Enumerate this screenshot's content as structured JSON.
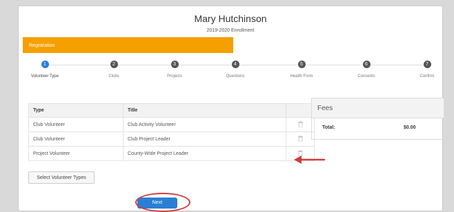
{
  "header": {
    "name": "Mary Hutchinson",
    "enrollment": "2019-2020 Enrollment"
  },
  "progress": {
    "label": "Registration"
  },
  "steps": [
    {
      "number": "1",
      "label": "Volunteer Type",
      "active": true
    },
    {
      "number": "2",
      "label": "Clubs"
    },
    {
      "number": "3",
      "label": "Projects"
    },
    {
      "number": "4",
      "label": "Questions"
    },
    {
      "number": "5",
      "label": "Health Form"
    },
    {
      "number": "6",
      "label": "Consents"
    },
    {
      "number": "7",
      "label": "Confirm"
    }
  ],
  "volunteer_table": {
    "headers": [
      "Type",
      "Title",
      ""
    ],
    "rows": [
      {
        "type": "Club Volunteer",
        "title": "Club Activity Volunteer"
      },
      {
        "type": "Club Volunteer",
        "title": "Club Project Leader"
      },
      {
        "type": "Project Volunteer",
        "title": "County-Wide Project Leader"
      }
    ]
  },
  "fees": {
    "heading": "Fees",
    "total_label": "Total:",
    "total_value": "$0.00"
  },
  "buttons": {
    "select_types": "Select Volunteer Types",
    "next": "Next"
  },
  "colors": {
    "progress_bar": "#f5a000",
    "primary": "#2a7fd4",
    "annotation": "#d23b3b"
  },
  "icons": {
    "delete": "trash-icon",
    "annotation": "red-arrow"
  }
}
